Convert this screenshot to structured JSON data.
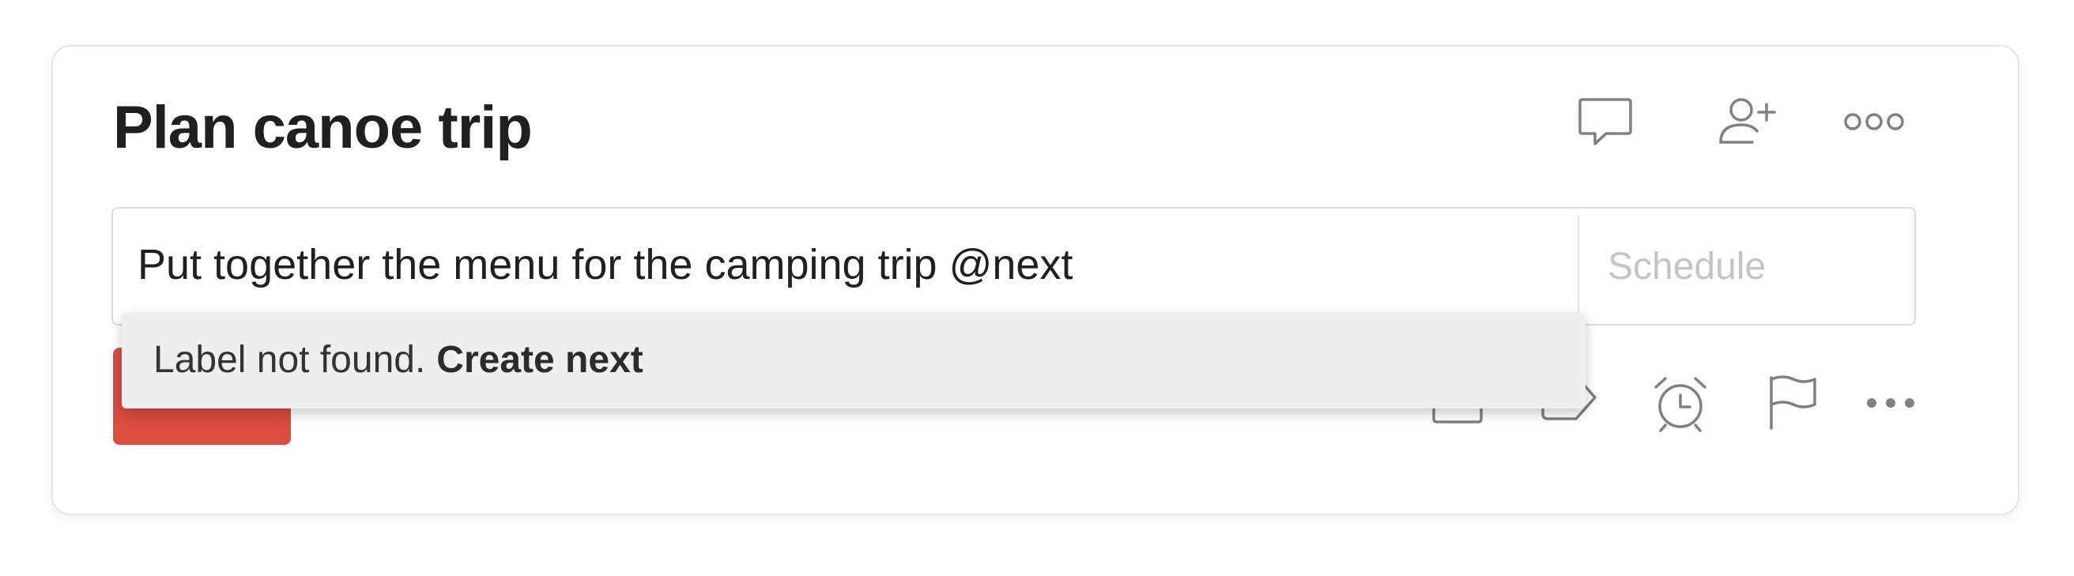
{
  "task": {
    "title": "Plan canoe trip",
    "input_value": "Put together the menu for the camping trip @next",
    "schedule_placeholder": "Schedule"
  },
  "header_icons": [
    "comment-icon",
    "add-person-icon",
    "more-options-icon"
  ],
  "toolbar_icons": [
    "project-icon",
    "label-icon",
    "reminder-alarm-icon",
    "priority-flag-icon",
    "more-actions-icon"
  ],
  "autocomplete": {
    "message": "Label not found.",
    "action": "Create next"
  },
  "colors": {
    "accent": "#db4c3f",
    "title_text": "#202020",
    "placeholder": "#c4c4c4",
    "dropdown_bg": "#eeeeee",
    "icon_stroke": "#808080"
  }
}
